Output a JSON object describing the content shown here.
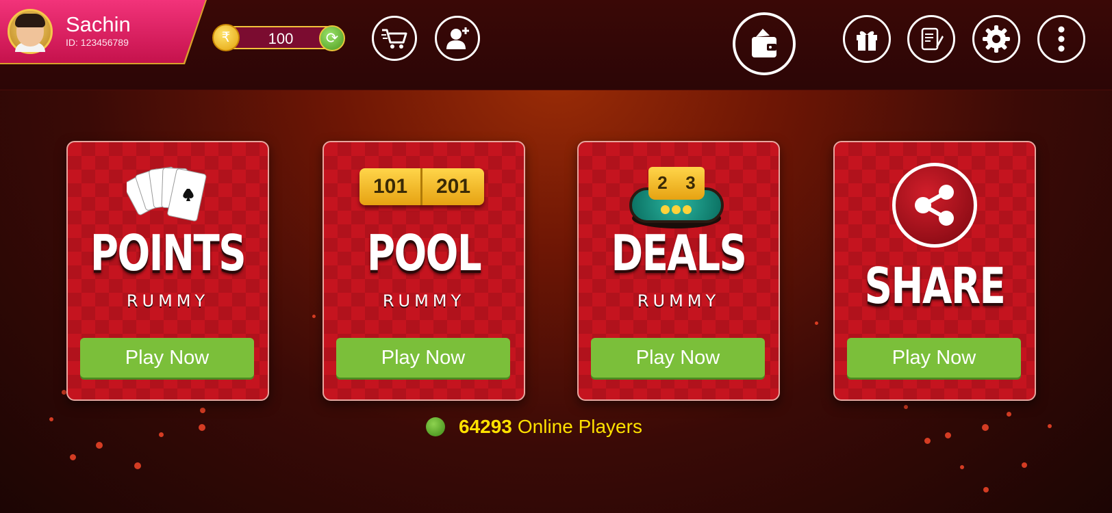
{
  "colors": {
    "accent_pink": "#e4276c",
    "card_red": "#c5141f",
    "play_green": "#7bbf3a",
    "online_yellow": "#ffe100",
    "coin_gold": "#f3c33b"
  },
  "profile": {
    "name": "Sachin",
    "id_text": "ID: 123456789",
    "avatar": "avatar"
  },
  "wallet_bar": {
    "currency_icon": "rupee-coin-icon",
    "balance": "100",
    "currency_symbol": "₹",
    "refresh_icon": "refresh-icon"
  },
  "toolbar": {
    "left_icons": [
      "cart-icon",
      "add-friend-icon"
    ],
    "center_icon": "wallet-icon",
    "right_icons": [
      "gift-icon",
      "scroll-icon",
      "gear-icon",
      "more-vertical-icon"
    ]
  },
  "games": [
    {
      "title": "POINTS",
      "subtitle": "RUMMY",
      "button": "Play Now",
      "art": "playing-cards-icon"
    },
    {
      "title": "POOL",
      "subtitle": "RUMMY",
      "button": "Play Now",
      "art": "pool-badge-icon",
      "badge_left": "101",
      "badge_right": "201"
    },
    {
      "title": "DEALS",
      "subtitle": "RUMMY",
      "button": "Play Now",
      "art": "deals-table-icon",
      "badge_left": "2",
      "badge_right": "3"
    },
    {
      "title": "SHARE",
      "subtitle": "",
      "button": "Play Now",
      "art": "share-icon"
    }
  ],
  "online": {
    "count": "64293",
    "label": "Online Players"
  }
}
